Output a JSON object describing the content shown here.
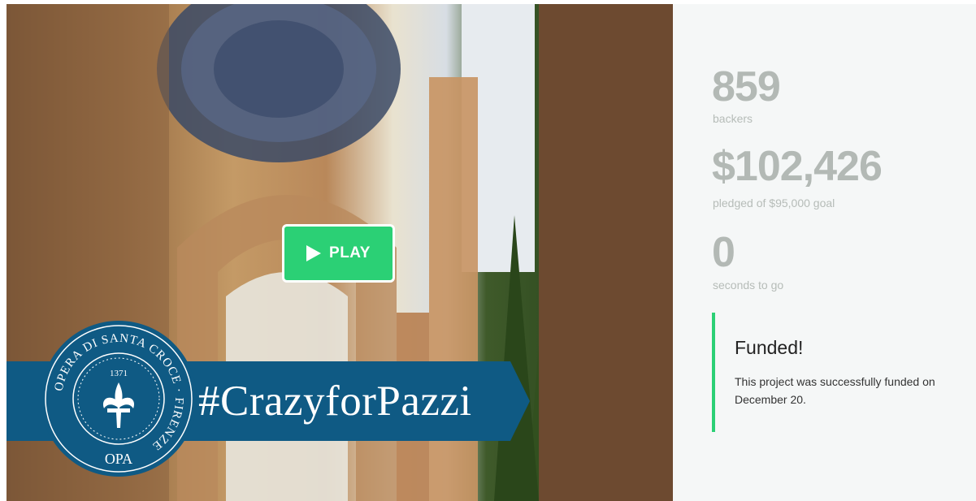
{
  "video": {
    "play_label": "PLAY",
    "hashtag": "#CrazyforPazzi",
    "seal": {
      "ring_text": "OPERA DI SANTA CROCE · FIRENZE",
      "year": "1371",
      "monogram": "OPA"
    }
  },
  "stats": {
    "backers": {
      "value": "859",
      "label": "backers"
    },
    "pledged": {
      "value": "$102,426",
      "label": "pledged of $95,000 goal"
    },
    "time": {
      "value": "0",
      "label": "seconds to go"
    }
  },
  "funded": {
    "title": "Funded!",
    "text": "This project was successfully funded on December 20."
  },
  "colors": {
    "accent": "#2bd075",
    "banner": "#0f5a84",
    "stat_text": "#b3b9b5",
    "panel_bg": "#f5f7f7"
  },
  "icons": [
    "play-icon",
    "fleur-de-lis-icon"
  ]
}
